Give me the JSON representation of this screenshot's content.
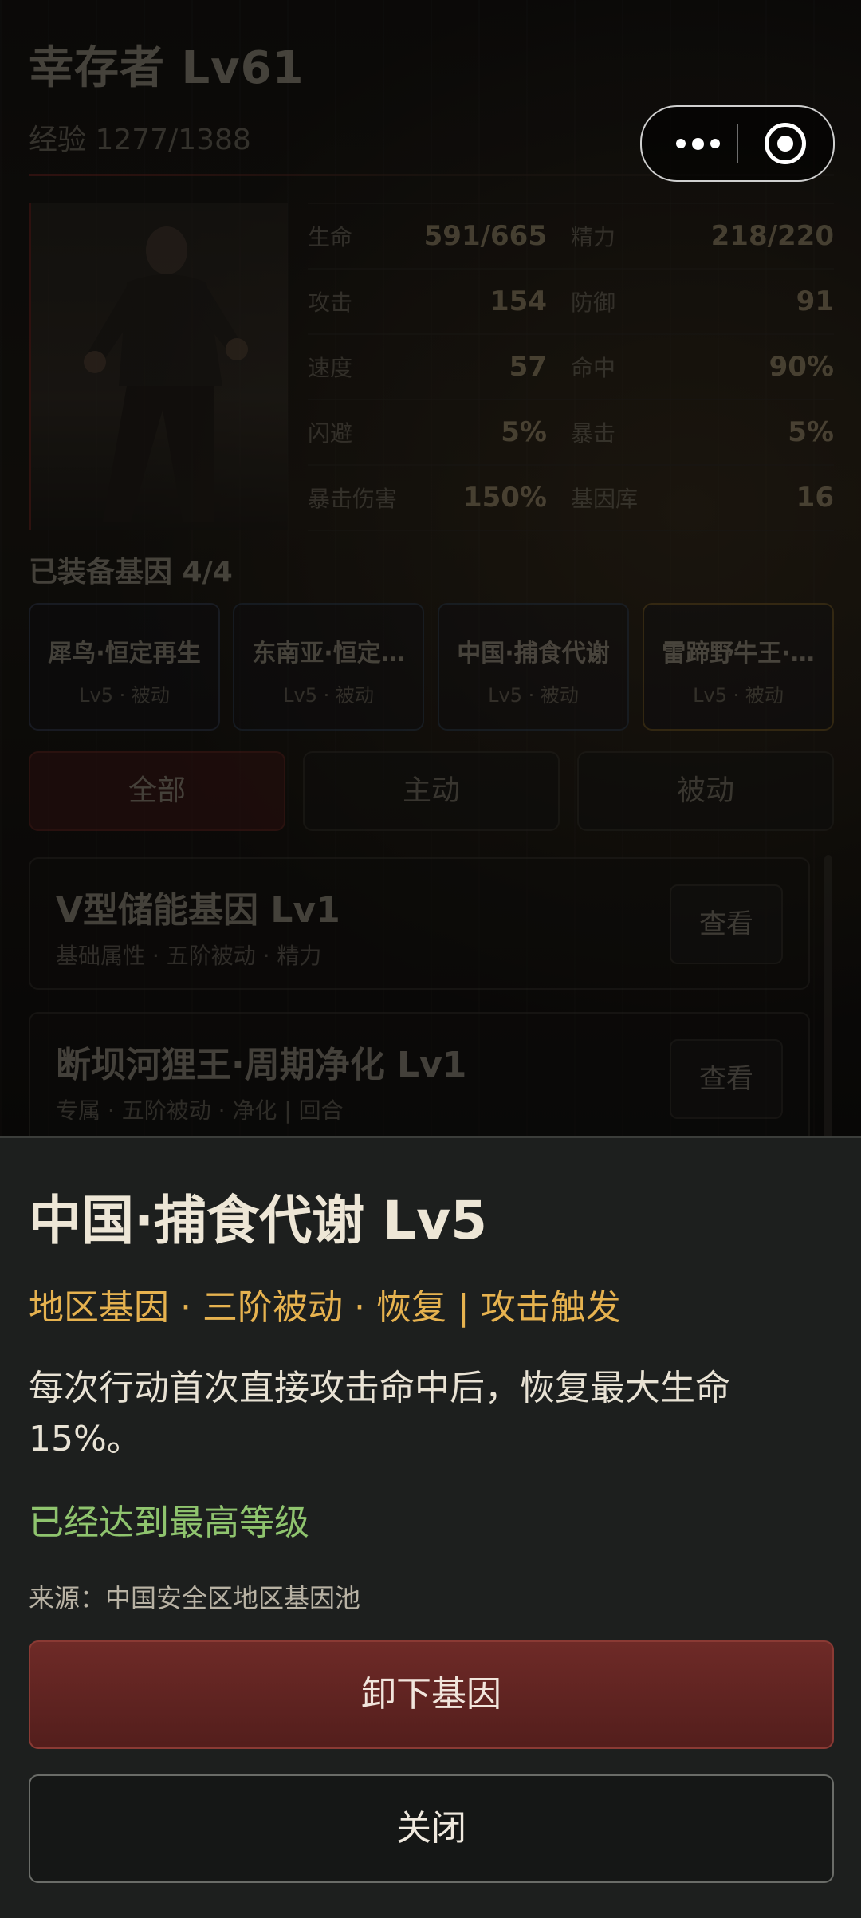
{
  "header": {
    "title": "幸存者 Lv61",
    "exp": "经验 1277/1388"
  },
  "stats": [
    {
      "label": "生命",
      "value": "591/665"
    },
    {
      "label": "精力",
      "value": "218/220"
    },
    {
      "label": "攻击",
      "value": "154"
    },
    {
      "label": "防御",
      "value": "91"
    },
    {
      "label": "速度",
      "value": "57"
    },
    {
      "label": "命中",
      "value": "90%"
    },
    {
      "label": "闪避",
      "value": "5%"
    },
    {
      "label": "暴击",
      "value": "5%"
    },
    {
      "label": "暴击伤害",
      "value": "150%"
    },
    {
      "label": "基因库",
      "value": "16"
    }
  ],
  "equipped": {
    "title": "已装备基因 4/4",
    "items": [
      {
        "name": "犀鸟·恒定再生",
        "sub": "Lv5 · 被动",
        "color": "#3e4a66"
      },
      {
        "name": "东南亚·恒定…",
        "sub": "Lv5 · 被动",
        "color": "#33475e"
      },
      {
        "name": "中国·捕食代谢",
        "sub": "Lv5 · 被动",
        "color": "#33475e"
      },
      {
        "name": "雷蹄野牛王·…",
        "sub": "Lv5 · 被动",
        "color": "#8a6a2a"
      }
    ]
  },
  "tabs": [
    "全部",
    "主动",
    "被动"
  ],
  "genes": [
    {
      "name": "V型储能基因 Lv1",
      "desc": "基础属性 · 五阶被动 · 精力",
      "button": "查看"
    },
    {
      "name": "断坝河狸王·周期净化 Lv1",
      "desc": "专属 · 五阶被动 · 净化 | 回合",
      "button": "查看"
    }
  ],
  "detail": {
    "title": "中国·捕食代谢 Lv5",
    "tags": "地区基因 · 三阶被动 · 恢复 | 攻击触发",
    "desc": "每次行动首次直接攻击命中后，恢复最大生命15%。",
    "max_level": "已经达到最高等级",
    "source": "来源：中国安全区地区基因池",
    "unload_button": "卸下基因",
    "close_button": "关闭"
  }
}
